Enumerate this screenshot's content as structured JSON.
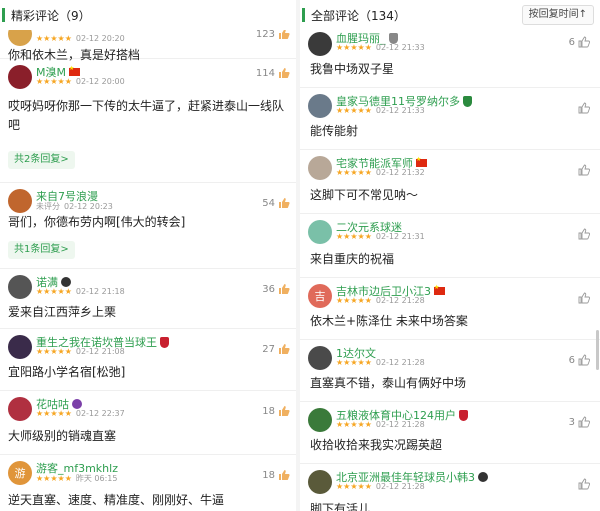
{
  "left_panel": {
    "title": "精彩评论（9）",
    "comments": [
      {
        "username": "",
        "badge": "none",
        "rating": "★★★★★",
        "time": "02-12 20:20",
        "likes": "123",
        "text": "你和依木兰，真是好搭档",
        "avatar_color": "#d8a24a"
      },
      {
        "username": "M溴M",
        "badge": "flag",
        "rating": "★★★★★",
        "time": "02-12 20:00",
        "likes": "114",
        "text": "哎呀妈呀你那一下传的太牛逼了，赶紧进泰山一线队吧",
        "reply": "共2条回复>",
        "avatar_color": "#8a1f2a"
      },
      {
        "username": "来自7号浪漫",
        "badge": "none",
        "rating": "未评分",
        "time": "02-12 20:23",
        "likes": "54",
        "text": "哥们，你德布劳内啊[伟大的转会]",
        "reply": "共1条回复>",
        "avatar_color": "#c0662e"
      },
      {
        "username": "诺满",
        "badge": "round",
        "rating": "★★★★★",
        "time": "02-12 21:18",
        "likes": "36",
        "text": "爱来自江西萍乡上栗",
        "avatar_color": "#555555"
      },
      {
        "username": "重生之我在诺坎普当球王",
        "badge": "shield",
        "rating": "★★★★★",
        "time": "02-12 21:08",
        "likes": "27",
        "text": "宜阳路小学名宿[松弛]",
        "avatar_color": "#3a2b4a"
      },
      {
        "username": "花咕咕",
        "badge": "purple",
        "rating": "★★★★★",
        "time": "02-12 22:37",
        "likes": "18",
        "text": "大师级别的销魂直塞",
        "avatar_color": "#b03040"
      },
      {
        "username": "游客_mf3mkhlz",
        "badge": "none",
        "rating": "★★★★★",
        "time": "昨天 06:15",
        "likes": "18",
        "text": "逆天直塞、速度、精准度、刚刚好、牛逼",
        "avatar_text": "游",
        "avatar_color": "#e0953a"
      }
    ]
  },
  "right_panel": {
    "title": "全部评论（134）",
    "sort_label": "按回复时间↑",
    "comments": [
      {
        "username": "血腥玛丽_",
        "badge": "grey",
        "rating": "★★★★★",
        "time": "02-12 21:33",
        "likes": "6",
        "text": "我鲁中场双子星",
        "avatar_color": "#3a3a3a"
      },
      {
        "username": "皇家马德里11号罗纳尔多",
        "badge": "green",
        "rating": "★★★★★",
        "time": "02-12 21:33",
        "likes": "",
        "text": "能传能射",
        "avatar_color": "#6a7a8a"
      },
      {
        "username": "宅家节能派军师",
        "badge": "flag",
        "rating": "★★★★★",
        "time": "02-12 21:32",
        "likes": "",
        "text": "这脚下可不常见呐～",
        "avatar_color": "#b8a898"
      },
      {
        "username": "二次元系球迷",
        "badge": "none",
        "rating": "★★★★★",
        "time": "02-12 21:31",
        "likes": "",
        "text": "来自重庆的祝福",
        "avatar_color": "#7ac0a8"
      },
      {
        "username": "吉林市边后卫小江3",
        "badge": "flag",
        "rating": "★★★★★",
        "time": "02-12 21:28",
        "likes": "",
        "text": "依木兰+陈泽仕 未来中场答案",
        "avatar_text": "吉",
        "avatar_color": "#e06a5a"
      },
      {
        "username": "1达尔文",
        "badge": "none",
        "rating": "★★★★★",
        "time": "02-12 21:28",
        "likes": "6",
        "text": "直塞真不错，泰山有俩好中场",
        "avatar_color": "#4a4a4a"
      },
      {
        "username": "五粮液体育中心124用户",
        "badge": "shield",
        "rating": "★★★★★",
        "time": "02-12 21:28",
        "likes": "3",
        "text": "收拾收拾来我实况踢英超",
        "avatar_color": "#3a7a3a"
      },
      {
        "username": "北京亚洲最佳年轻球员小韩3",
        "badge": "round",
        "rating": "★★★★★",
        "time": "02-12 21:28",
        "likes": "",
        "text": "脚下有活儿",
        "avatar_color": "#5a5a3a"
      }
    ]
  },
  "colors": {
    "accent": "#2e9e4f",
    "star": "#f6a623"
  }
}
